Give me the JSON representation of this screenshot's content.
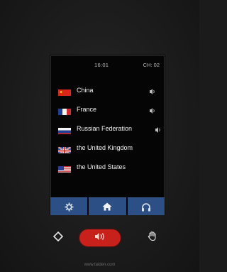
{
  "status": {
    "time": "16:01",
    "channel": "CH: 02"
  },
  "languages": [
    {
      "name": "China",
      "flag": "china-flag",
      "has_speak_icon": true
    },
    {
      "name": "France",
      "flag": "france-flag",
      "has_speak_icon": true
    },
    {
      "name": "Russian Federation",
      "flag": "russia-flag",
      "has_speak_icon": true
    },
    {
      "name": "the United Kingdom",
      "flag": "uk-flag",
      "has_speak_icon": false
    },
    {
      "name": "the United States",
      "flag": "us-flag",
      "has_speak_icon": false
    }
  ],
  "toolbar": {
    "buttons": [
      {
        "icon": "gear-icon"
      },
      {
        "icon": "home-icon"
      },
      {
        "icon": "headphones-icon"
      }
    ],
    "accent": "#2c4f86"
  },
  "hardware": {
    "left_icon": "diamond-icon",
    "center_icon": "speak-icon",
    "center_color": "#c8201b",
    "right_icon": "hand-icon"
  },
  "footer": {
    "website": "www.taiden.com"
  }
}
